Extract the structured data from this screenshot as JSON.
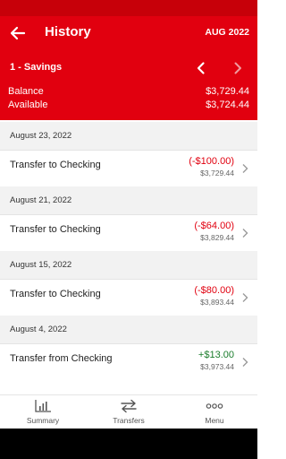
{
  "header": {
    "title": "History",
    "period": "AUG 2022",
    "account_name": "1 - Savings",
    "balance_label": "Balance",
    "balance_value": "$3,729.44",
    "available_label": "Available",
    "available_value": "$3,724.44"
  },
  "groups": [
    {
      "date": "August 23, 2022",
      "description": "Transfer to Checking",
      "amount": "(-$100.00)",
      "balance": "$3,729.44"
    },
    {
      "date": "August 21, 2022",
      "description": "Transfer to Checking",
      "amount": "(-$64.00)",
      "balance": "$3,829.44"
    },
    {
      "date": "August 15, 2022",
      "description": "Transfer to Checking",
      "amount": "(-$80.00)",
      "balance": "$3,893.44"
    },
    {
      "date": "August 4, 2022",
      "description": "Transfer from Checking",
      "amount": "+$13.00",
      "balance": "$3,973.44"
    }
  ],
  "nav": {
    "items": [
      {
        "label": "Summary",
        "icon": "bar-chart-icon"
      },
      {
        "label": "Transfers",
        "icon": "transfer-arrows-icon"
      },
      {
        "label": "Menu",
        "icon": "more-dots-icon"
      }
    ]
  },
  "colors": {
    "brand_red": "#e1000f",
    "status_red": "#c70009",
    "negative": "#e1000f",
    "positive": "#1b7d2c"
  }
}
